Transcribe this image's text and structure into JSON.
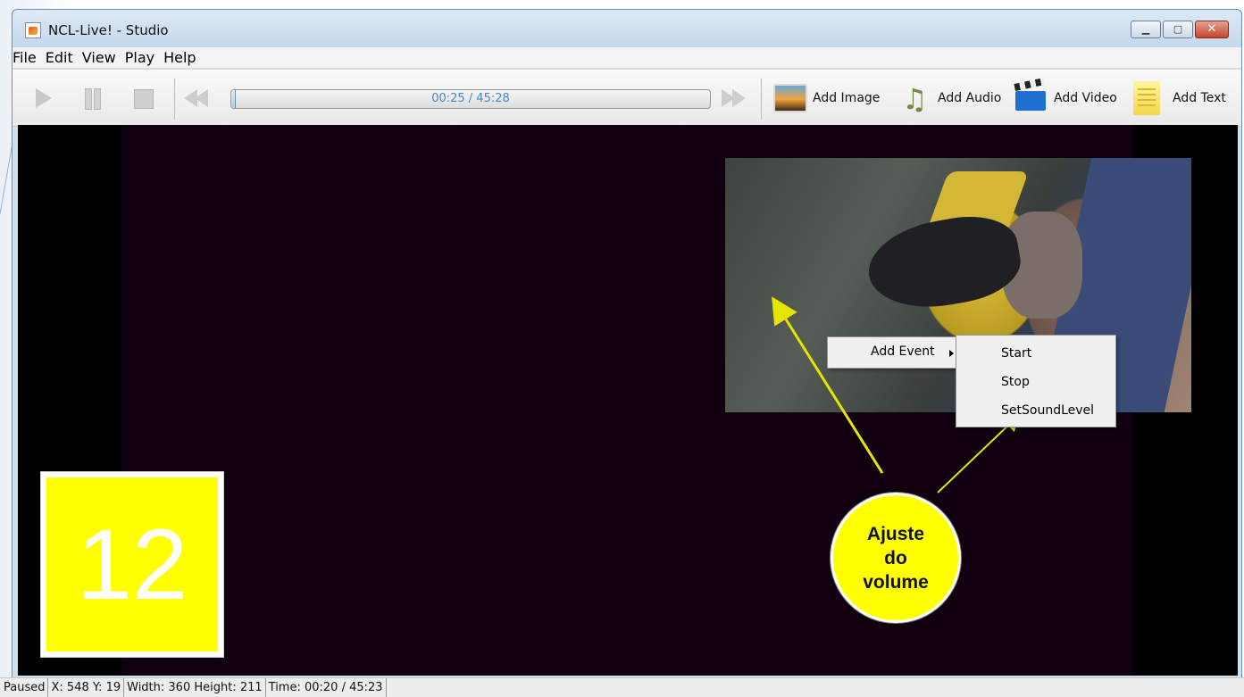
{
  "window": {
    "title": "NCL-Live! - Studio",
    "controls": [
      "minimize",
      "maximize",
      "close"
    ]
  },
  "menu": [
    "File",
    "Edit",
    "View",
    "Play",
    "Help"
  ],
  "toolbar": {
    "playback": {
      "time": "00:25 / 45:28",
      "progress_fraction": 0.009
    },
    "add_image_label": "Add Image",
    "add_audio_label": "Add Audio",
    "add_video_label": "Add Video",
    "add_text_label": "Add Text",
    "icons": [
      "play-icon",
      "pause-icon",
      "stop-icon",
      "rewind-icon",
      "fast-forward-icon",
      "image-icon",
      "audio-icon",
      "video-icon",
      "text-icon"
    ]
  },
  "context_menu": {
    "item": "Add Event",
    "submenu": [
      "Start",
      "Stop",
      "SetSoundLevel"
    ]
  },
  "callout": [
    "Ajuste",
    "do",
    "volume"
  ],
  "slide_number": "12",
  "status": {
    "state": "Paused",
    "position": "X: 548 Y: 19",
    "size": "Width: 360 Height: 211",
    "time": "Time: 00:20 / 45:23"
  },
  "colors": {
    "callout": "#ffff00",
    "stage": "#100010",
    "progress_text": "#4a88c2"
  }
}
